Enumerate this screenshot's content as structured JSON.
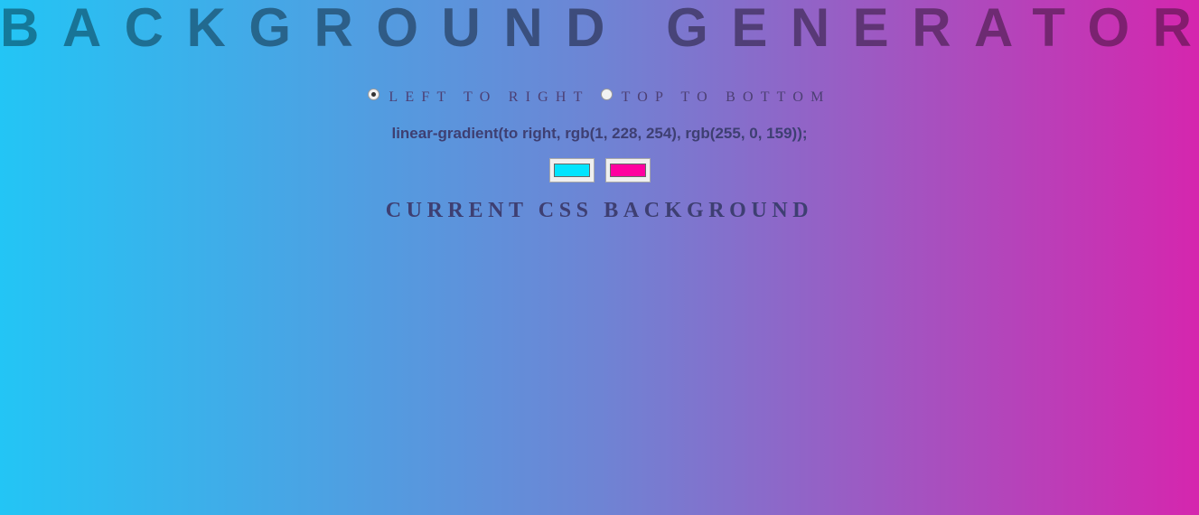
{
  "page": {
    "title": "BACKGROUND GENERATOR",
    "subtitle": "CURRENT CSS BACKGROUND"
  },
  "direction": {
    "options": [
      {
        "label": "LEFT TO RIGHT",
        "checked": true
      },
      {
        "label": "TOP TO BOTTOM",
        "checked": false
      }
    ]
  },
  "css_output": "linear-gradient(to right, rgb(1, 228, 254), rgb(255, 0, 159));",
  "colors": {
    "color1": "#01e4fe",
    "color2": "#ff009f"
  }
}
